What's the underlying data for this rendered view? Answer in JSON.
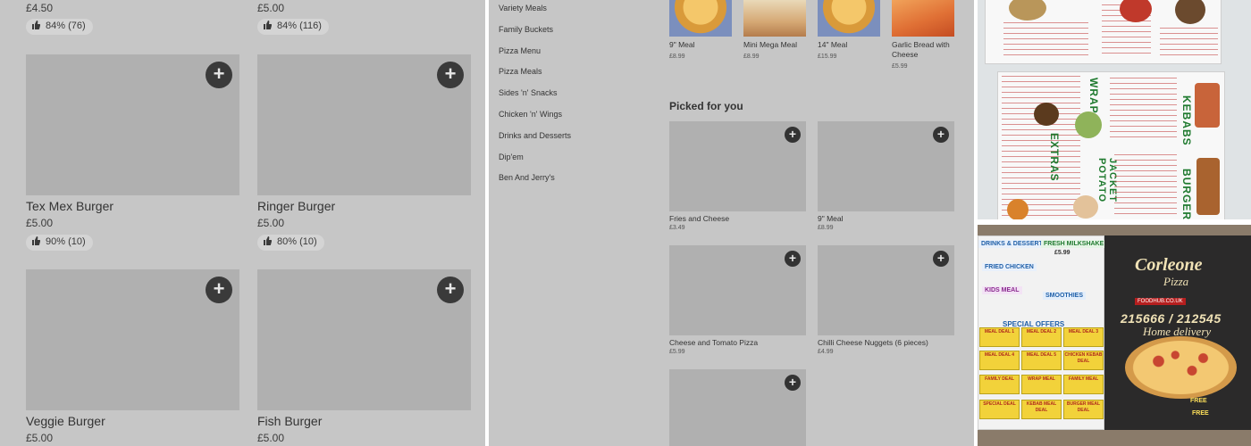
{
  "panel_a": {
    "top_prices": [
      "£4.50",
      "£5.00"
    ],
    "top_ratings": [
      "84% (76)",
      "84% (116)"
    ],
    "items": [
      {
        "name": "Tex Mex Burger",
        "price": "£5.00",
        "rating": "90% (10)"
      },
      {
        "name": "Ringer Burger",
        "price": "£5.00",
        "rating": "80% (10)"
      },
      {
        "name": "Veggie Burger",
        "price": "£5.00",
        "rating": ""
      },
      {
        "name": "Fish Burger",
        "price": "£5.00",
        "rating": ""
      }
    ],
    "add_symbol": "+"
  },
  "panel_b": {
    "categories": [
      "Variety Meals",
      "Family Buckets",
      "Pizza Menu",
      "Pizza Meals",
      "Sides 'n' Snacks",
      "Chicken 'n' Wings",
      "Drinks and Desserts",
      "Dip'em",
      "Ben And Jerry's"
    ],
    "top_items": [
      {
        "name": "9\" Meal",
        "price": "£8.99"
      },
      {
        "name": "Mini Mega Meal",
        "price": "£8.99"
      },
      {
        "name": "14\" Meal",
        "price": "£15.99"
      },
      {
        "name": "Garlic Bread with Cheese",
        "price": "£5.99"
      }
    ],
    "section_title": "Picked for you",
    "picked": [
      {
        "name": "Fries and Cheese",
        "price": "£3.49"
      },
      {
        "name": "9\" Meal",
        "price": "£8.99"
      },
      {
        "name": "Cheese and Tomato Pizza",
        "price": "£5.99"
      },
      {
        "name": "Chilli Cheese Nuggets (6 pieces)",
        "price": "£4.99"
      },
      {
        "name": "",
        "price": ""
      }
    ],
    "add_symbol": "+"
  },
  "panel_c": {
    "photo1": {
      "wraps": "WRAPS",
      "kebabs": "KEBABS",
      "extras": "EXTRAS",
      "jacket": "JACKET POTATO",
      "burgers": "BURGERS"
    },
    "photo2": {
      "drinks": "DRINKS & DESSERTS",
      "milkshake": "FRESH MILKSHAKE",
      "milkshake_price": "£5.99",
      "fried_chicken": "FRIED CHICKEN",
      "kids_meal": "KIDS MEAL",
      "smoothies": "SMOOTHIES",
      "special_offers": "SPECIAL OFFERS",
      "deals": [
        "MEAL DEAL 1",
        "MEAL DEAL 2",
        "MEAL DEAL 3",
        "MEAL DEAL 4",
        "MEAL DEAL 5",
        "CHICKEN KEBAB DEAL",
        "FAMILY DEAL",
        "WRAP MEAL",
        "FAMILY MEAL",
        "SPECIAL DEAL",
        "KEBAB MEAL DEAL",
        "BURGER MEAL DEAL"
      ],
      "brand": "Corleone",
      "brand_sub": "Pizza",
      "website": "FOODHUB.CO.UK",
      "phone": "215666 / 212545",
      "home_delivery": "Home delivery",
      "free": "FREE"
    }
  }
}
